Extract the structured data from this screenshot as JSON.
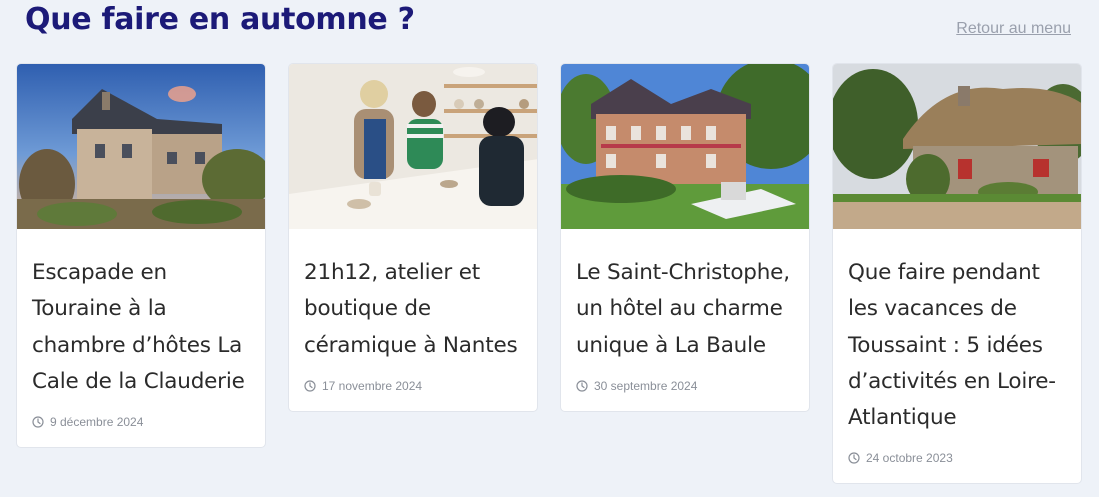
{
  "section": {
    "title": "Que faire en automne ?",
    "back_link": "Retour au menu"
  },
  "cards": [
    {
      "title": "Escapade en Touraine à la chambre d’hôtes La Cale de la Clauderie",
      "date": "9 décembre 2024",
      "image": "house-at-sunset-photo"
    },
    {
      "title": "21h12, atelier et boutique de céramique à Nantes",
      "date": "17 novembre 2024",
      "image": "ceramic-workshop-photo"
    },
    {
      "title": "Le Saint-Christophe, un hôtel au charme unique à La Baule",
      "date": "30 septembre 2024",
      "image": "hotel-garden-photo"
    },
    {
      "title": "Que faire pendant les vacances de Toussaint : 5 idées d’activités en Loire-Atlantique",
      "date": "24 octobre 2023",
      "image": "thatched-cottage-photo"
    }
  ],
  "colors": {
    "title": "#1c1a78",
    "background": "#eef2f8",
    "card_text": "#2b2b2b",
    "meta_text": "#8a8f98"
  },
  "icons": [
    "clock-icon"
  ]
}
